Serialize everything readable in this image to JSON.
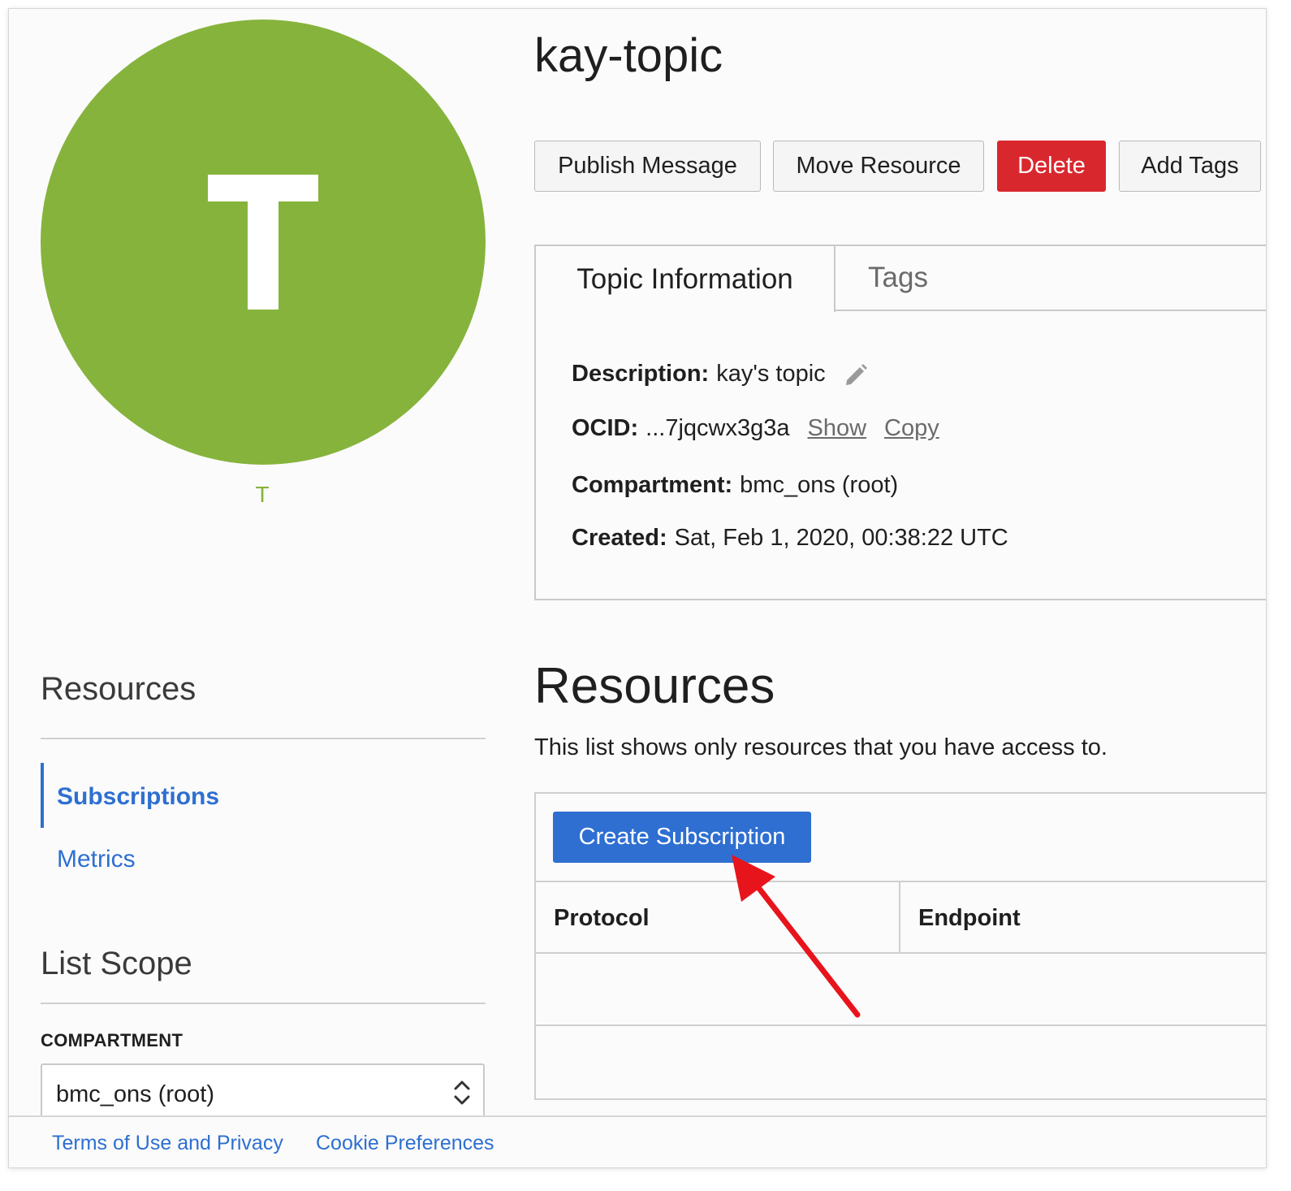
{
  "avatar": {
    "letter": "T",
    "caption": "T",
    "color": "#86b33c"
  },
  "topic": {
    "title": "kay-topic"
  },
  "actions": {
    "publish": "Publish Message",
    "move": "Move Resource",
    "delete": "Delete",
    "add_tags": "Add Tags"
  },
  "tabs": {
    "active": "Topic Information",
    "inactive": "Tags"
  },
  "info": {
    "description_label": "Description:",
    "description_value": "kay's topic",
    "ocid_label": "OCID:",
    "ocid_value": "...7jqcwx3g3a",
    "ocid_show": "Show",
    "ocid_copy": "Copy",
    "compartment_label": "Compartment:",
    "compartment_value": "bmc_ons (root)",
    "created_label": "Created:",
    "created_value": "Sat, Feb 1, 2020, 00:38:22 UTC"
  },
  "resources": {
    "title": "Resources",
    "subtitle": "This list shows only resources that you have access to.",
    "create_button": "Create Subscription",
    "columns": [
      "Protocol",
      "Endpoint"
    ]
  },
  "sidebar": {
    "heading": "Resources",
    "items": [
      {
        "label": "Subscriptions",
        "active": true
      },
      {
        "label": "Metrics",
        "active": false
      }
    ],
    "scope_heading": "List Scope",
    "compartment_label": "COMPARTMENT",
    "compartment_value": "bmc_ons (root)"
  },
  "footer": {
    "terms": "Terms of Use and Privacy",
    "cookies": "Cookie Preferences"
  },
  "colors": {
    "accent": "#2e6fd1",
    "danger": "#d9272e",
    "annotation_arrow": "#e8141c"
  },
  "icons": [
    "pencil-icon",
    "chevron-up-down-icon",
    "annotation-arrow-icon"
  ]
}
